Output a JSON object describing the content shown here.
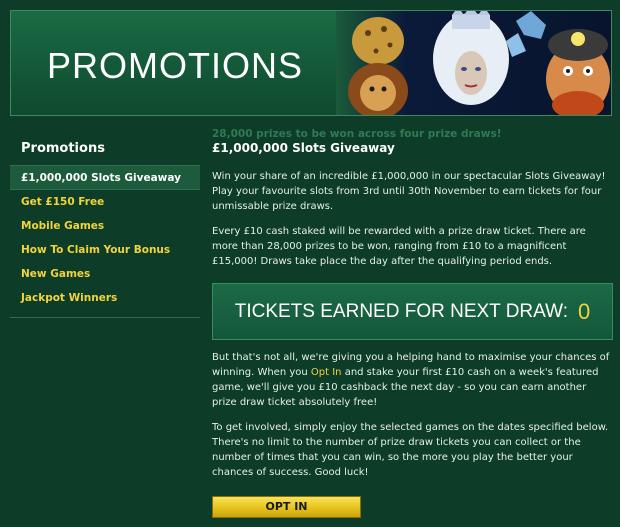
{
  "banner": {
    "title": "PROMOTIONS"
  },
  "sidebar": {
    "title": "Promotions",
    "items": [
      {
        "label": "£1,000,000 Slots Giveaway"
      },
      {
        "label": "Get £150 Free"
      },
      {
        "label": "Mobile Games"
      },
      {
        "label": "How To Claim Your Bonus"
      },
      {
        "label": "New Games"
      },
      {
        "label": "Jackpot Winners"
      }
    ]
  },
  "main": {
    "faded_text": "28,000 prizes to be won across four prize draws!",
    "heading": "£1,000,000 Slots Giveaway",
    "para1": "Win your share of an incredible £1,000,000 in our spectacular Slots Giveaway! Play your favourite slots from 3rd until 30th November to earn tickets for four unmissable prize draws.",
    "para2": "Every £10 cash staked will be rewarded with a prize draw ticket. There are more than 28,000 prizes to be won, ranging from £10 to a magnificent £15,000! Draws take place the day after the qualifying period ends.",
    "tickets_label": "TICKETS EARNED FOR NEXT DRAW:",
    "tickets_count": "0",
    "para3_a": "But that's not all, we're giving you a helping hand to maximise your chances of winning. When you ",
    "para3_link": "Opt In",
    "para3_b": " and stake your first £10 cash on a week's featured game, we'll give you £10 cashback the next day - so you can earn another prize draw ticket absolutely free!",
    "para4": "To get involved, simply enjoy the selected games on the dates specified below. There's no limit to the number of prize draw tickets you can collect or the number of times that you can win, so the more you play the better your chances of success. Good luck!",
    "optin_label": "OPT IN"
  },
  "colors": {
    "accent": "#f2d33a",
    "background": "#0d3d28",
    "panel": "#1b6a46"
  }
}
